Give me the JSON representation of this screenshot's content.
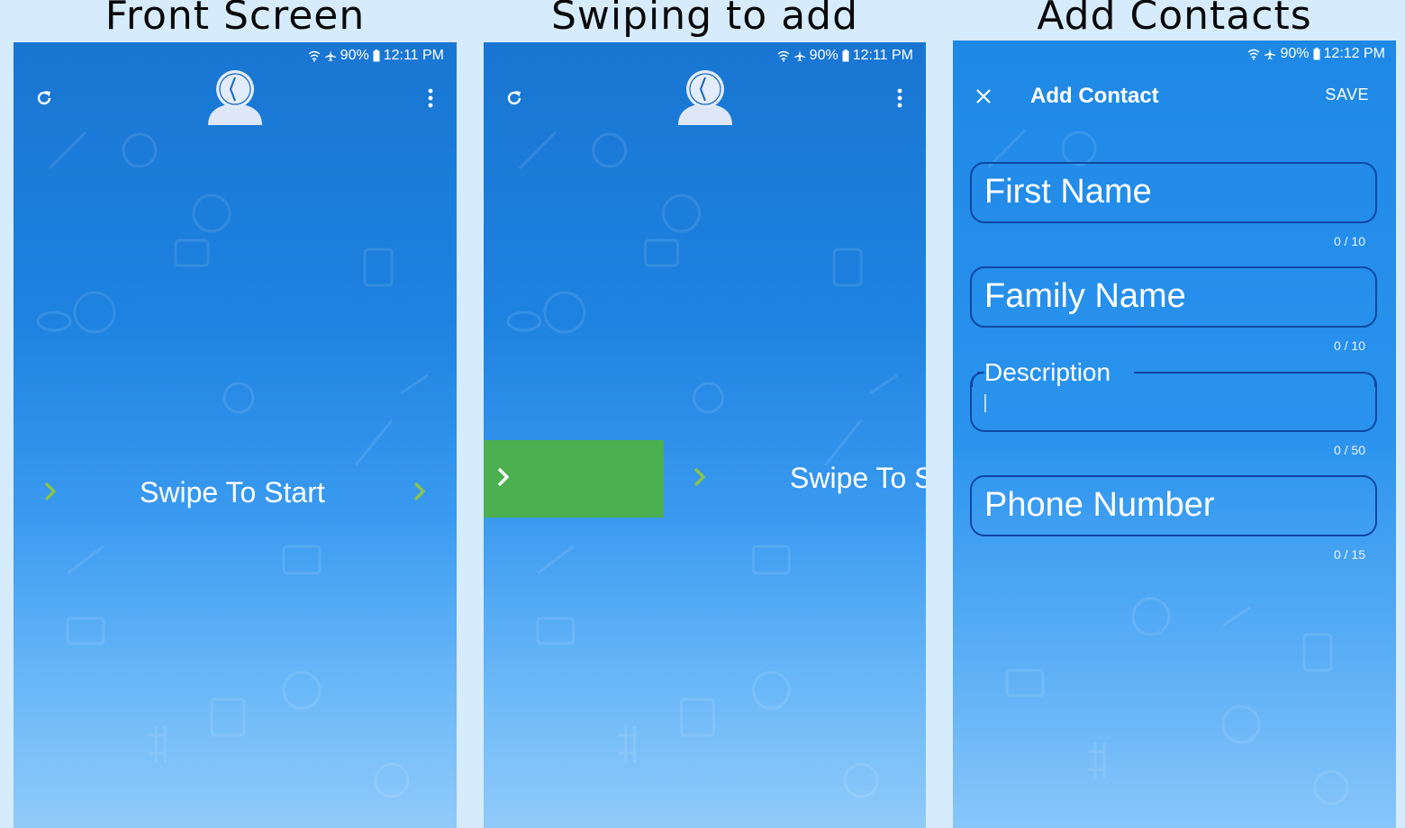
{
  "captions": {
    "front": "Front Screen",
    "swiping": "Swiping to add",
    "add": "Add Contacts"
  },
  "screens": {
    "front": {
      "status": {
        "battery": "90%",
        "time": "12:11 PM"
      },
      "swipe_label": "Swipe To Start"
    },
    "swiping": {
      "status": {
        "battery": "90%",
        "time": "12:11 PM"
      },
      "swipe_label": "Swipe To S"
    },
    "add_contact": {
      "status": {
        "battery": "90%",
        "time": "12:12 PM"
      },
      "title": "Add Contact",
      "save_label": "SAVE",
      "fields": [
        {
          "label": "First Name",
          "counter": "0 / 10"
        },
        {
          "label": "Family Name",
          "counter": "0 / 10"
        },
        {
          "label": "Description",
          "counter": "0 / 50"
        },
        {
          "label": "Phone Number",
          "counter": "0 / 15"
        }
      ]
    }
  },
  "colors": {
    "accent_green": "#4caf50",
    "chevron_green": "#8bc34a",
    "field_border": "#0d47a1"
  },
  "icons": [
    "refresh-icon",
    "more-vert-icon",
    "clock-user-avatar-icon",
    "chevron-right-icon",
    "close-icon",
    "wifi-icon",
    "airplane-icon",
    "battery-icon"
  ]
}
